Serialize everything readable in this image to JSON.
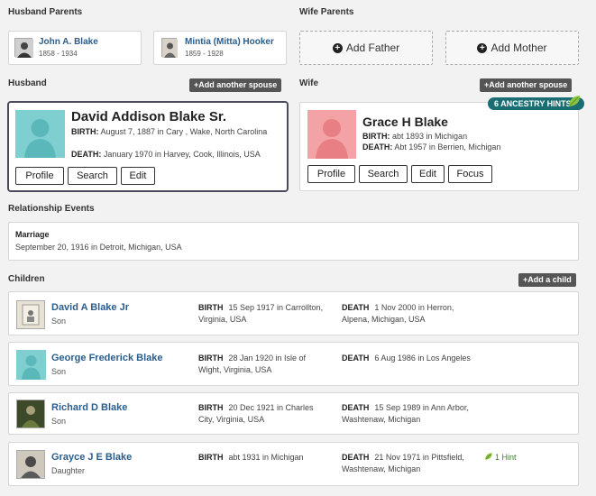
{
  "husband_parents": {
    "title": "Husband Parents",
    "father": {
      "name": "John A. Blake",
      "dates": "1858 - 1934"
    },
    "mother": {
      "name": "Mintia (Mitta) Hooker",
      "dates": "1859 - 1928"
    }
  },
  "wife_parents": {
    "title": "Wife Parents",
    "add_father": "Add Father",
    "add_mother": "Add Mother"
  },
  "husband": {
    "title": "Husband",
    "add_spouse": "+Add another spouse",
    "name": "David Addison Blake Sr.",
    "birth_label": "BIRTH:",
    "birth": "August 7, 1887 in Cary , Wake, North Carolina",
    "death_label": "DEATH:",
    "death": "January 1970 in Harvey, Cook, Illinois, USA",
    "buttons": {
      "profile": "Profile",
      "search": "Search",
      "edit": "Edit"
    }
  },
  "wife": {
    "title": "Wife",
    "add_spouse": "+Add another spouse",
    "hints": "6 ANCESTRY HINTS",
    "name": "Grace H Blake",
    "birth_label": "BIRTH:",
    "birth": "abt 1893 in Michigan",
    "death_label": "DEATH:",
    "death": "Abt 1957 in Berrien, Michigan",
    "buttons": {
      "profile": "Profile",
      "search": "Search",
      "edit": "Edit",
      "focus": "Focus"
    }
  },
  "relationship": {
    "title": "Relationship Events",
    "event_label": "Marriage",
    "event_detail": "September 20, 1916 in Detroit, Michigan, USA"
  },
  "children": {
    "title": "Children",
    "add_child": "+Add a child",
    "items": [
      {
        "name": "David A Blake Jr",
        "rel": "Son",
        "birth_label": "BIRTH",
        "birth": "15 Sep 1917 in Carrollton, Virginia, USA",
        "death_label": "DEATH",
        "death": "1 Nov 2000 in Herron, Alpena, Michigan, USA",
        "hint": ""
      },
      {
        "name": "George Frederick Blake",
        "rel": "Son",
        "birth_label": "BIRTH",
        "birth": "28 Jan 1920 in Isle of Wight, Virginia, USA",
        "death_label": "DEATH",
        "death": "6 Aug 1986 in Los Angeles",
        "hint": ""
      },
      {
        "name": "Richard D Blake",
        "rel": "Son",
        "birth_label": "BIRTH",
        "birth": "20 Dec 1921 in Charles City, Virginia, USA",
        "death_label": "DEATH",
        "death": "15 Sep 1989 in Ann Arbor, Washtenaw, Michigan",
        "hint": ""
      },
      {
        "name": "Grayce J E Blake",
        "rel": "Daughter",
        "birth_label": "BIRTH",
        "birth": "abt 1931 in Michigan",
        "death_label": "DEATH",
        "death": "21 Nov 1971 in Pittsfield, Washtenaw, Michigan",
        "hint": "1 Hint"
      }
    ]
  },
  "colors": {
    "link": "#2a5d8c",
    "male_avatar": "#7fcfd0",
    "female_avatar": "#f3a3a6",
    "hint_badge": "#1a6e73",
    "leaf": "#8cc63f"
  }
}
